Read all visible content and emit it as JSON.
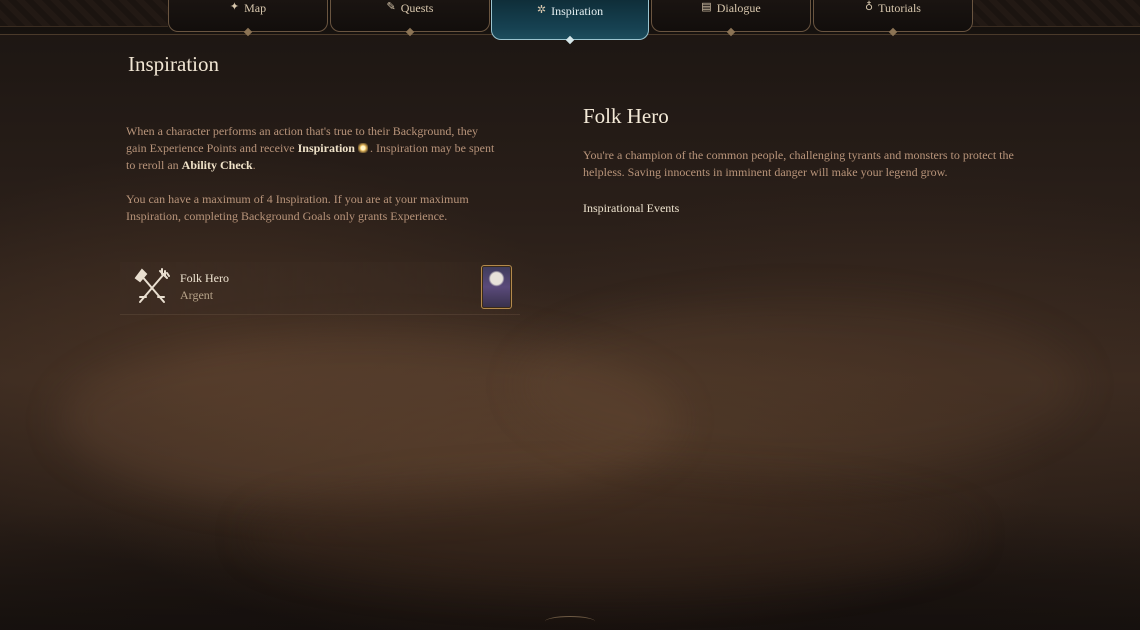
{
  "tabs": [
    {
      "label": "Map",
      "icon": "compass-icon",
      "glyph": "✦"
    },
    {
      "label": "Quests",
      "icon": "quill-icon",
      "glyph": "✎"
    },
    {
      "label": "Inspiration",
      "icon": "inspiration-star-icon",
      "glyph": "✲",
      "active": true
    },
    {
      "label": "Dialogue",
      "icon": "book-icon",
      "glyph": "▤"
    },
    {
      "label": "Tutorials",
      "icon": "lightbulb-icon",
      "glyph": "♁"
    }
  ],
  "left": {
    "title": "Inspiration",
    "p1_a": "When a character performs an action that's true to their Background, they gain Experience Points and receive ",
    "p1_hl1": "Inspiration",
    "p1_b": ". Inspiration may be spent to reroll an ",
    "p1_hl2": "Ability Check",
    "p1_c": ".",
    "p2": "You can have a maximum of 4 Inspiration. If you are at your maximum Inspiration, completing Background Goals only grants Experience.",
    "background": {
      "name": "Folk Hero",
      "subtitle": "Argent",
      "icon": "crossed-shovel-pitchfork-icon"
    }
  },
  "right": {
    "title": "Folk Hero",
    "description": "You're a champion of the common people, challenging tyrants and monsters to protect the helpless. Saving innocents in imminent danger will make your legend grow.",
    "events_label": "Inspirational Events"
  }
}
